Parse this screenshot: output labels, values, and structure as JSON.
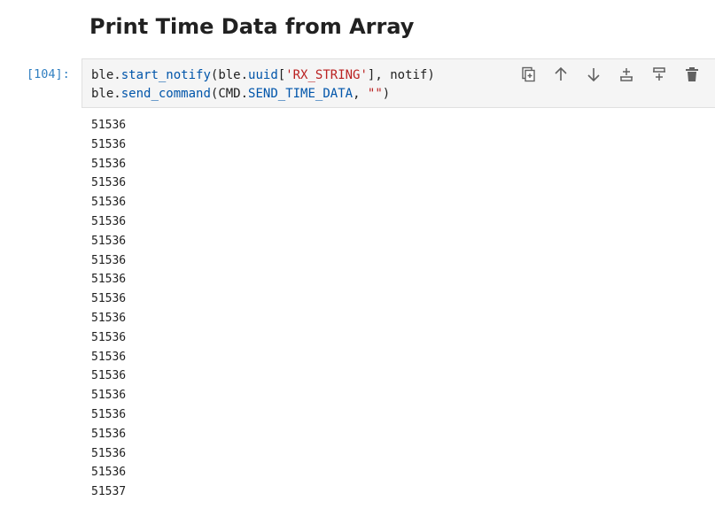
{
  "heading": "Print Time Data from Array",
  "cell": {
    "prompt": "[104]:",
    "code_lines": [
      [
        {
          "t": "ble",
          "c": "var"
        },
        {
          "t": ".",
          "c": "punc"
        },
        {
          "t": "start_notify",
          "c": "attr"
        },
        {
          "t": "(ble",
          "c": "var"
        },
        {
          "t": ".",
          "c": "punc"
        },
        {
          "t": "uuid",
          "c": "attr"
        },
        {
          "t": "[",
          "c": "punc"
        },
        {
          "t": "'RX_STRING'",
          "c": "str"
        },
        {
          "t": "], notif)",
          "c": "punc"
        }
      ],
      [
        {
          "t": "ble",
          "c": "var"
        },
        {
          "t": ".",
          "c": "punc"
        },
        {
          "t": "send_command",
          "c": "attr"
        },
        {
          "t": "(CMD",
          "c": "var"
        },
        {
          "t": ".",
          "c": "punc"
        },
        {
          "t": "SEND_TIME_DATA",
          "c": "attr"
        },
        {
          "t": ", ",
          "c": "punc"
        },
        {
          "t": "\"\"",
          "c": "str"
        },
        {
          "t": ")",
          "c": "punc"
        }
      ]
    ]
  },
  "toolbar": [
    {
      "name": "duplicate-cell-icon",
      "title": "Duplicate cell"
    },
    {
      "name": "move-up-icon",
      "title": "Move cell up"
    },
    {
      "name": "move-down-icon",
      "title": "Move cell down"
    },
    {
      "name": "insert-above-icon",
      "title": "Insert cell above"
    },
    {
      "name": "insert-below-icon",
      "title": "Insert cell below"
    },
    {
      "name": "delete-icon",
      "title": "Delete cell"
    }
  ],
  "output_lines": [
    "51536",
    "51536",
    "51536",
    "51536",
    "51536",
    "51536",
    "51536",
    "51536",
    "51536",
    "51536",
    "51536",
    "51536",
    "51536",
    "51536",
    "51536",
    "51536",
    "51536",
    "51536",
    "51536",
    "51537"
  ],
  "colors": {
    "prompt": "#307fc1",
    "attribute": "#0055aa",
    "string": "#ba2121",
    "cell_bg": "#f5f5f5",
    "icon": "#616161"
  }
}
